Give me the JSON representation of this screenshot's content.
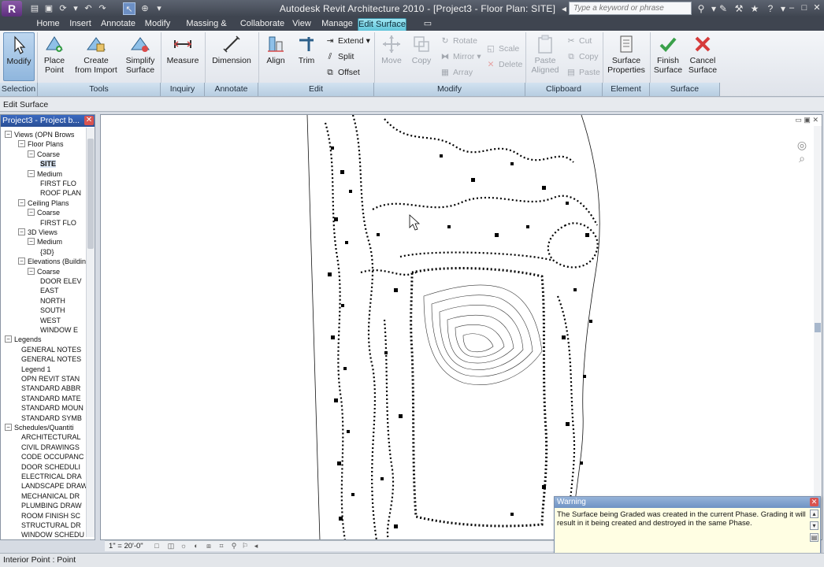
{
  "title_bar": {
    "app_title": "Autodesk Revit Architecture 2010 - [Project3 - Floor Plan: SITE]",
    "search_placeholder": "Type a keyword or phrase",
    "app_logo": "R"
  },
  "tabs": [
    {
      "label": "Home"
    },
    {
      "label": "Insert"
    },
    {
      "label": "Annotate"
    },
    {
      "label": "Modify"
    },
    {
      "label": "Massing & Site"
    },
    {
      "label": "Collaborate"
    },
    {
      "label": "View"
    },
    {
      "label": "Manage"
    },
    {
      "label": "Edit Surface",
      "active": true
    }
  ],
  "ribbon": {
    "modify": "Modify",
    "place_point": "Place\nPoint",
    "create_from_import": "Create\nfrom Import",
    "simplify_surface": "Simplify\nSurface",
    "measure": "Measure",
    "dimension": "Dimension",
    "align": "Align",
    "trim": "Trim",
    "extend": "Extend",
    "split": "Split",
    "offset": "Offset",
    "move": "Move",
    "copy": "Copy",
    "rotate": "Rotate",
    "mirror": "Mirror",
    "array": "Array",
    "scale": "Scale",
    "delete": "Delete",
    "paste_aligned": "Paste\nAligned",
    "cut": "Cut",
    "copy_clip": "Copy",
    "paste": "Paste",
    "surface_properties": "Surface\nProperties",
    "finish_surface": "Finish\nSurface",
    "cancel_surface": "Cancel\nSurface"
  },
  "panels": {
    "selection": "Selection",
    "tools": "Tools",
    "inquiry": "Inquiry",
    "annotate": "Annotate",
    "edit": "Edit",
    "modify": "Modify",
    "clipboard": "Clipboard",
    "element": "Element",
    "surface": "Surface"
  },
  "options_bar": {
    "label": "Edit Surface"
  },
  "project_browser": {
    "title": "Project3 - Project b...",
    "items": [
      {
        "label": "Views (OPN Brows",
        "level": 0
      },
      {
        "label": "Floor Plans",
        "level": 1
      },
      {
        "label": "Coarse",
        "level": 2
      },
      {
        "label": "SITE",
        "level": 3,
        "selected": true
      },
      {
        "label": "Medium",
        "level": 2
      },
      {
        "label": "FIRST FLO",
        "level": 3
      },
      {
        "label": "ROOF PLAN",
        "level": 3
      },
      {
        "label": "Ceiling Plans",
        "level": 1
      },
      {
        "label": "Coarse",
        "level": 2
      },
      {
        "label": "FIRST FLO",
        "level": 3
      },
      {
        "label": "3D Views",
        "level": 1
      },
      {
        "label": "Medium",
        "level": 2
      },
      {
        "label": "{3D}",
        "level": 3
      },
      {
        "label": "Elevations (Buildin",
        "level": 1
      },
      {
        "label": "Coarse",
        "level": 2
      },
      {
        "label": "DOOR ELEV",
        "level": 3
      },
      {
        "label": "EAST",
        "level": 3
      },
      {
        "label": "NORTH",
        "level": 3
      },
      {
        "label": "SOUTH",
        "level": 3
      },
      {
        "label": "WEST",
        "level": 3
      },
      {
        "label": "WINDOW E",
        "level": 3
      },
      {
        "label": "Legends",
        "level": 0
      },
      {
        "label": "GENERAL NOTES",
        "level": 1
      },
      {
        "label": "GENERAL NOTES",
        "level": 1
      },
      {
        "label": "Legend 1",
        "level": 1
      },
      {
        "label": "OPN REVIT STAN",
        "level": 1
      },
      {
        "label": "STANDARD ABBR",
        "level": 1
      },
      {
        "label": "STANDARD MATE",
        "level": 1
      },
      {
        "label": "STANDARD MOUN",
        "level": 1
      },
      {
        "label": "STANDARD SYMB",
        "level": 1
      },
      {
        "label": "Schedules/Quantiti",
        "level": 0
      },
      {
        "label": "ARCHITECTURAL",
        "level": 1
      },
      {
        "label": "CIVIL DRAWINGS",
        "level": 1
      },
      {
        "label": "CODE OCCUPANC",
        "level": 1
      },
      {
        "label": "DOOR SCHEDULI",
        "level": 1
      },
      {
        "label": "ELECTRICAL DRA",
        "level": 1
      },
      {
        "label": "LANDSCAPE DRAW",
        "level": 1
      },
      {
        "label": "MECHANICAL DR",
        "level": 1
      },
      {
        "label": "PLUMBING DRAW",
        "level": 1
      },
      {
        "label": "ROOM FINISH SC",
        "level": 1
      },
      {
        "label": "STRUCTURAL DR",
        "level": 1
      },
      {
        "label": "WINDOW SCHEDU",
        "level": 1
      }
    ]
  },
  "view_bar": {
    "scale": "1\" = 20'-0\""
  },
  "warning": {
    "title": "Warning",
    "message": "The Surface being Graded was created in the current Phase. Grading it will result in it being created and destroyed in the same Phase."
  },
  "status_bar": {
    "text": "Interior Point : Point"
  }
}
